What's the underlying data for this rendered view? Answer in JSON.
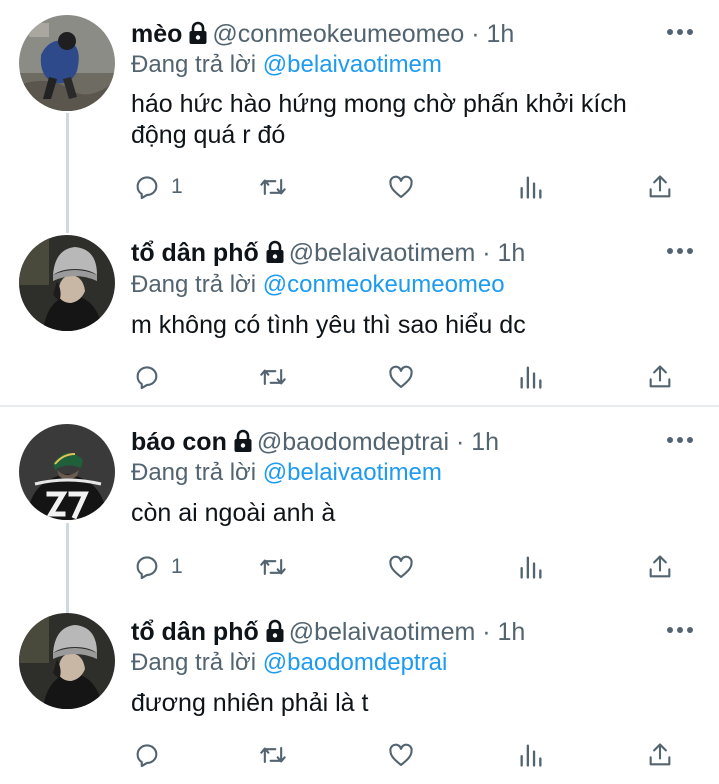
{
  "reply_prefix": "Đang trả lời",
  "replies": [
    {
      "name": "mèo",
      "handle": "@conmeokeumeomeo",
      "time": "1h",
      "replying_to": "@belaivaotimem",
      "text": "háo hức hào hứng mong chờ phấn khởi kích động quá r đó",
      "reply_count": "1",
      "avatar": "avatar-photo-crouching-person"
    },
    {
      "name": "tổ dân phố",
      "handle": "@belaivaotimem",
      "time": "1h",
      "replying_to": "@conmeokeumeomeo",
      "text": "m không có tình yêu thì sao hiểu dc",
      "reply_count": "",
      "avatar": "avatar-photo-grey-beanie"
    },
    {
      "name": "báo con",
      "handle": "@baodomdeptrai",
      "time": "1h",
      "replying_to": "@belaivaotimem",
      "text": "còn ai ngoài anh à",
      "reply_count": "1",
      "avatar": "avatar-photo-readymade-27-jersey"
    },
    {
      "name": "tổ dân phố",
      "handle": "@belaivaotimem",
      "time": "1h",
      "replying_to": "@baodomdeptrai",
      "text": "đương nhiên phải là t",
      "reply_count": "",
      "avatar": "avatar-photo-grey-beanie"
    }
  ],
  "colors": {
    "link": "#1d9bf0",
    "muted": "#536471",
    "text": "#0f1419",
    "thread_line": "#cfd9de"
  },
  "icons": [
    "lock-icon",
    "more-icon",
    "reply-icon",
    "retweet-icon",
    "like-icon",
    "views-icon",
    "share-icon"
  ]
}
